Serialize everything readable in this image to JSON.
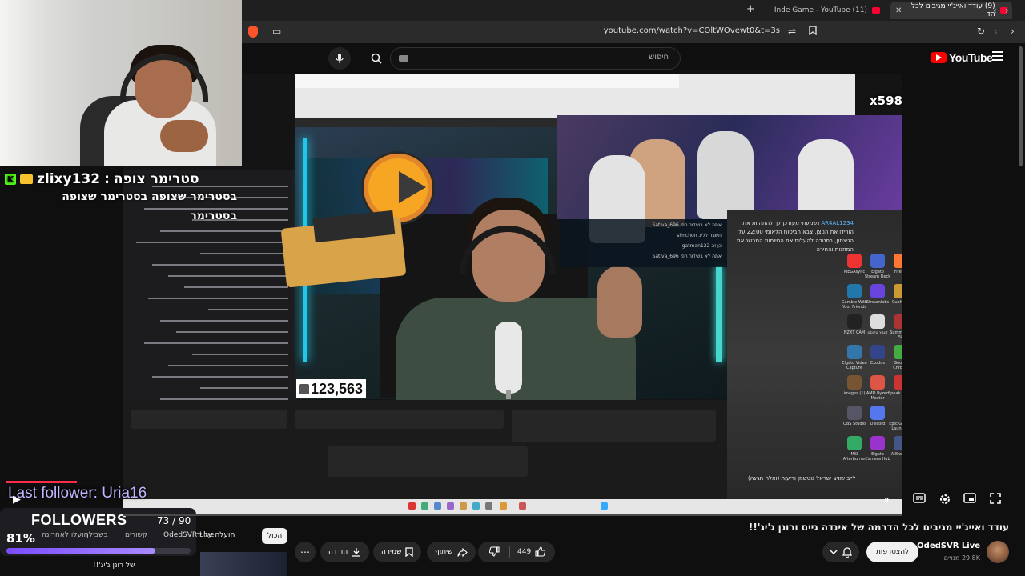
{
  "browser": {
    "tabs": [
      {
        "title": "(9) עודד ואייג'יי מגיבים לכל הד",
        "active": true
      },
      {
        "title": "(11) Inde Game - YouTube",
        "active": false
      }
    ],
    "new_tab": "+",
    "url": "youtube.com/watch?v=COltWOvewt0&t=3s"
  },
  "youtube": {
    "logo_text": "YouTube",
    "search_placeholder": "חיפוש"
  },
  "video": {
    "viewer_count": "123,563",
    "multiplier": "x598",
    "inner_title": "לייב שוויצ ישראל גוטשמן וריעות (ואלה חגיגה)",
    "desktop_text": "נשמעתי מעודכן לך להתהוות את הורידו את הניצן, צבא הביטוח הלאומי 22:00 על הניצחון, במטרה להעלות את הסיומות המבשג את המחנות והחירה",
    "desktop_icons": [
      "MEGAsync",
      "Elgato Stream Deck",
      "Firefox",
      "Gamble With Your Friends",
      "Streamlabs",
      "Cuphead",
      "NZXT CAM",
      "קובץ טקסט",
      "Summer of 58",
      "Elgato Video Capture",
      "Exodus",
      "Google Chrome",
      "images (1)",
      "AMD Ryzen Master",
      "Speak Demo",
      "OBS Studio",
      "Discord",
      "Epic Games Launcher",
      "MSI Afterburner",
      "Elgato Camera Hub",
      "AllSwatch"
    ],
    "overlay_chat": [
      "Sativa_696 אתה לא בשידור הפי",
      "simchon תשבר לליב",
      "gatman122 כן זה",
      "Sativa_696 אתה לא בשידור הפי"
    ],
    "overlay_user": "AR4AL1234"
  },
  "stream_overlay": {
    "alert_user": "zlixy132",
    "alert_sep": ":",
    "alert_label": "סטרימר צופה",
    "alert_message": "בסטרימר שצופה בסטרימר שצופה בסטרימר",
    "last_follower": "Last follower: Uria16",
    "followers_title": "FOLLOWERS",
    "followers_count": "73 / 90",
    "followers_percent": "81%",
    "followers_progress": 0.81
  },
  "below_video": {
    "title": "עודד ואייג'יי מגיבים לכל הדרמה של אינדה גיים ורונן ג'יג'!!",
    "channel_name": "OdedSVR Live",
    "subscribers": "29.8K מנויים",
    "subscribe_label": "להצטרפות",
    "likes": "449",
    "share_label": "שיתוף",
    "save_label": "שמירה",
    "download_label": "הורדה",
    "chips": {
      "all": "הכול",
      "uploaded_by": "הועלה על ידי",
      "uploaded_by_channel": "OdedSVR Live",
      "related": "קשורים",
      "watched": "בשבילך",
      "recent": "הועלו לאחרונה"
    },
    "rec_title": "של רונן ג'יג'!!"
  },
  "colors": {
    "yt_red": "#ff0000",
    "kick_green": "#53fc18",
    "follower_purple": "#7b4cff",
    "bg": "#0f0f0f"
  }
}
